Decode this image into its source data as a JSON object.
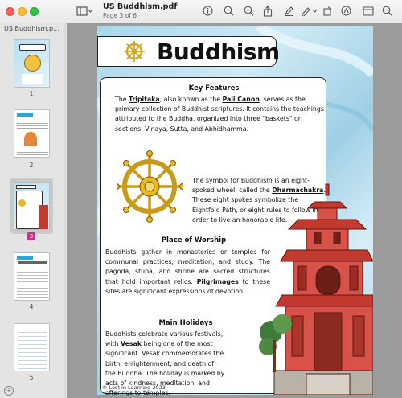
{
  "window": {
    "title": "US Buddhism.pdf",
    "subtitle": "Page 3 of 6"
  },
  "sidebar": {
    "header": "US Buddhism.p...",
    "pages": [
      {
        "number": "1"
      },
      {
        "number": "2"
      },
      {
        "number": "3",
        "selected": true
      },
      {
        "number": "4"
      },
      {
        "number": "5"
      }
    ]
  },
  "page": {
    "title": "Buddhism",
    "key_features": {
      "heading": "Key Features",
      "pre1": "The ",
      "term1": "Tripitaka",
      "mid1": ", also known as the ",
      "term2": "Pali Canon",
      "post1": ", serves as the primary collection of Buddhist scriptures. It contains the teachings attributed to the Buddha, organized into three \"baskets\" or sections: Vinaya, Sutta, and Abhidhamma."
    },
    "symbol": {
      "pre": "The symbol for Buddhism is an eight-spoked wheel, called the ",
      "term": "Dharmachakra",
      "post": ". These eight spokes symbolize the Eightfold Path, or eight rules to follow in  order to live an honorable life."
    },
    "worship": {
      "heading": "Place of Worship",
      "pre": "Buddhists gather in monasteries or temples for communal practices, meditation, and study. The pagoda, stupa, and shrine are sacred structures that hold important relics. ",
      "term": "Pilgrimages",
      "post": " to these sites are significant expressions of devotion."
    },
    "holidays": {
      "heading": "Main Holidays",
      "pre": "Buddhists celebrate various festivals, with ",
      "term": "Vesak",
      "post": " being one of the most significant. Vesak commemorates the birth, enlightenment, and death of the Buddha. The holiday is marked by acts of kindness, meditation, and offerings to temples."
    },
    "footer": "© Lost in Learning 2023"
  },
  "colors": {
    "accent_badge": "#c5318b",
    "wheel_gold": "#e8b923",
    "pagoda_red": "#c23a2f"
  }
}
